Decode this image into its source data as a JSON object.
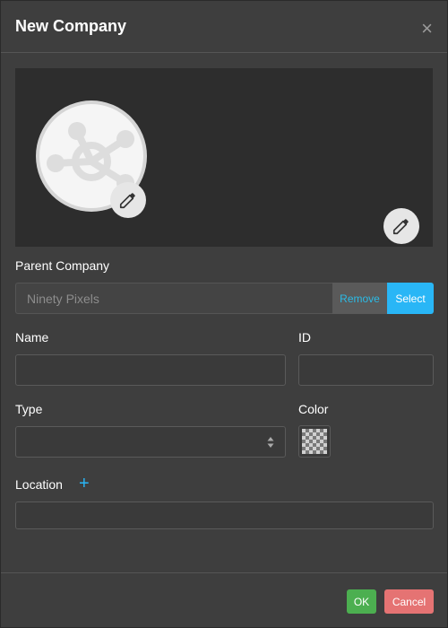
{
  "dialog": {
    "title": "New Company",
    "close_icon": "close-icon",
    "close_glyph": "×"
  },
  "media": {
    "logo_icon": "network-hub-icon",
    "edit_icon": "pencil-icon"
  },
  "parent_company": {
    "label": "Parent Company",
    "value": "Ninety Pixels",
    "remove_label": "Remove",
    "select_label": "Select"
  },
  "name": {
    "label": "Name",
    "value": ""
  },
  "id": {
    "label": "ID",
    "value": ""
  },
  "type": {
    "label": "Type",
    "value": ""
  },
  "color": {
    "label": "Color",
    "value": "transparent"
  },
  "location": {
    "label": "Location",
    "add_glyph": "+",
    "value": ""
  },
  "footer": {
    "ok_label": "OK",
    "cancel_label": "Cancel"
  },
  "theme": {
    "background": "#3e3e3e",
    "accent": "#29b6f6",
    "ok": "#4caf50",
    "cancel": "#e57373"
  }
}
